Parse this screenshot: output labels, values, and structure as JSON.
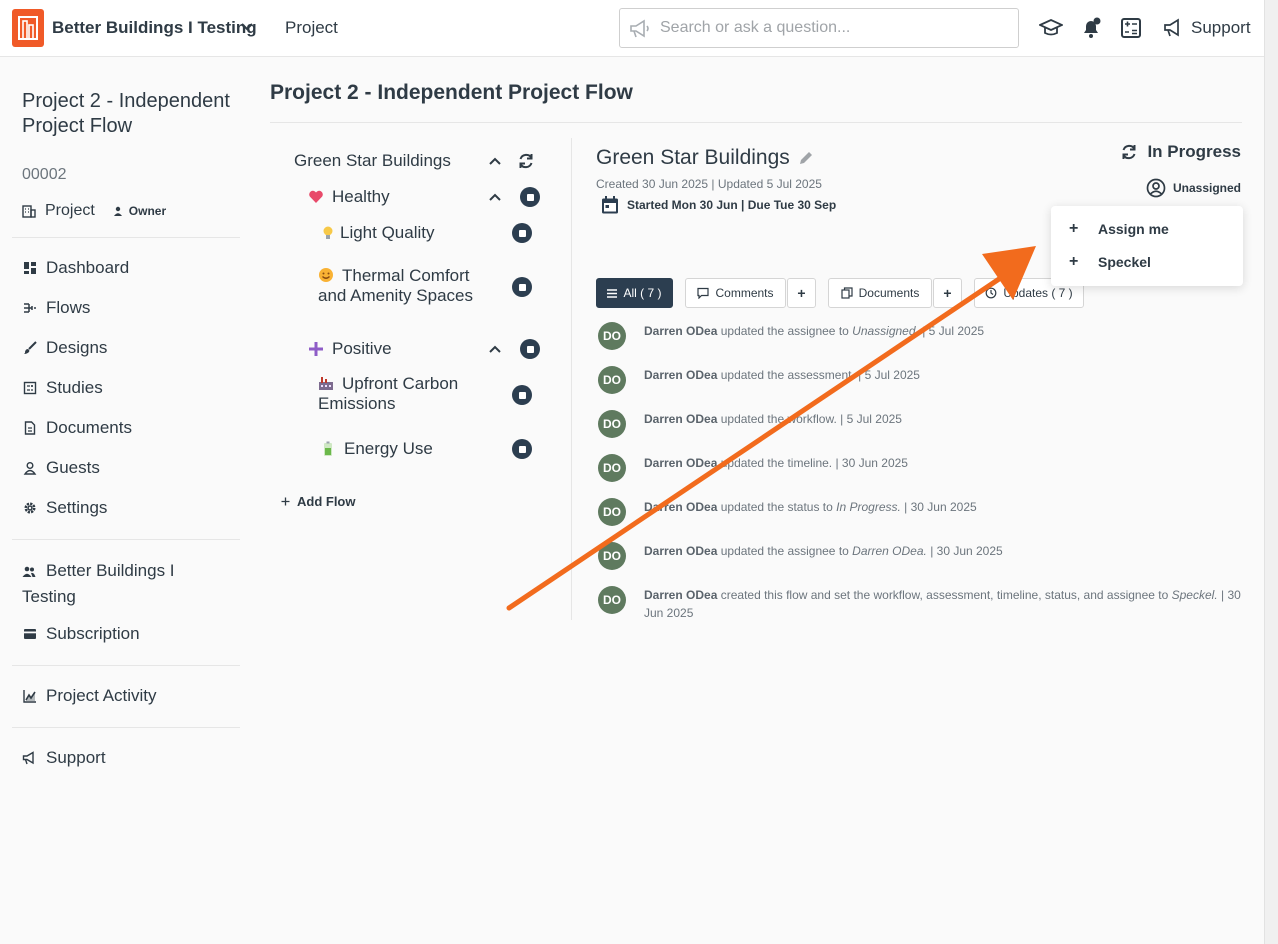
{
  "colors": {
    "brand": "#f05a28",
    "dark": "#2c3e50",
    "arrow": "#f26b1d",
    "avatar": "#5f7a5f"
  },
  "topbar": {
    "org_name": "Better Buildings I Testing",
    "project_link": "Project",
    "search_placeholder": "Search or ask a question...",
    "support": "Support"
  },
  "sidebar": {
    "project_title": "Project 2 - Independent Project Flow",
    "project_code": "00002",
    "project_label": "Project",
    "owner_label": "Owner",
    "nav": {
      "dashboard": "Dashboard",
      "flows": "Flows",
      "designs": "Designs",
      "studies": "Studies",
      "documents": "Documents",
      "guests": "Guests",
      "settings": "Settings",
      "org": "Better Buildings I Testing",
      "subscription": "Subscription",
      "project_activity": "Project Activity",
      "support": "Support"
    }
  },
  "main": {
    "title": "Project 2 - Independent Project Flow",
    "tree": {
      "root": "Green Star Buildings",
      "healthy": "Healthy",
      "light_quality": "Light Quality",
      "thermal_comfort": "Thermal Comfort and Amenity Spaces",
      "positive": "Positive",
      "upfront_carbon": "Upfront Carbon Emissions",
      "energy_use": "Energy Use",
      "add_flow": "Add Flow"
    },
    "detail": {
      "name": "Green Star Buildings",
      "meta": "Created 30 Jun 2025 | Updated 5 Jul 2025",
      "dates": "Started Mon 30 Jun | Due Tue 30 Sep",
      "status": "In Progress",
      "assignee": "Unassigned",
      "dropdown": {
        "assign_me": "Assign me",
        "speckel": "Speckel"
      },
      "tabs": {
        "all": "All ( 7 )",
        "comments": "Comments",
        "add": "+",
        "documents": "Documents",
        "updates": "Updates ( 7 )"
      }
    },
    "activity": [
      {
        "initials": "DO",
        "user": "Darren ODea",
        "pre": "updated the assignee to ",
        "em": "Unassigned.",
        "post": " | 5 Jul 2025"
      },
      {
        "initials": "DO",
        "user": "Darren ODea",
        "pre": "updated the assessment.",
        "em": "",
        "post": " | 5 Jul 2025"
      },
      {
        "initials": "DO",
        "user": "Darren ODea",
        "pre": "updated the workflow.",
        "em": "",
        "post": " | 5 Jul 2025"
      },
      {
        "initials": "DO",
        "user": "Darren ODea",
        "pre": "updated the timeline.",
        "em": "",
        "post": " | 30 Jun 2025"
      },
      {
        "initials": "DO",
        "user": "Darren ODea",
        "pre": "updated the status to ",
        "em": "In Progress.",
        "post": " | 30 Jun 2025"
      },
      {
        "initials": "DO",
        "user": "Darren ODea",
        "pre": "updated the assignee to ",
        "em": "Darren ODea.",
        "post": " | 30 Jun 2025"
      },
      {
        "initials": "DO",
        "user": "Darren ODea",
        "pre": "created this flow and set the workflow, assessment, timeline, status, and assignee to ",
        "em": "Speckel.",
        "post": " | 30 Jun 2025"
      }
    ]
  }
}
